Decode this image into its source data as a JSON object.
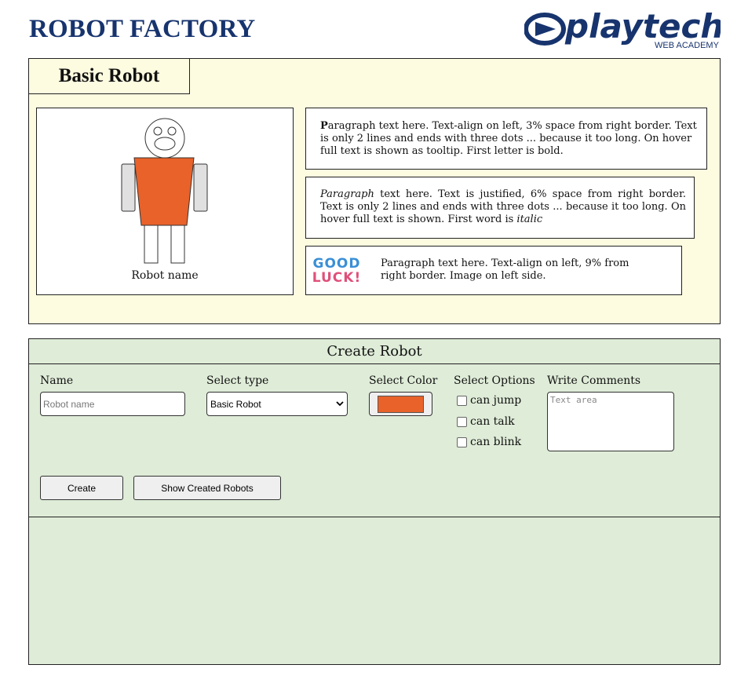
{
  "header": {
    "title": "ROBOT FACTORY",
    "logo": {
      "brand": "playtech",
      "subtitle": "WEB ACADEMY",
      "color": "#17346e"
    }
  },
  "robot_panel": {
    "tab_label": "Basic Robot",
    "robot_name": "Robot name",
    "robot_color": "#e8622a",
    "paragraphs": {
      "p1": {
        "first_letter": "P",
        "rest": "aragraph text here. Text-align on left, 3% space from right border. Text is only 2 lines and ends with three dots ... because it too long. On hover full text is shown as tooltip. First letter is bold."
      },
      "p2": {
        "first_word": "Paragraph",
        "middle": " text here. Text is justified, 6% space from right border. Text is only 2 lines and ends with three dots ... because it too long. On hover full text is shown. First word is ",
        "last_word": "italic"
      },
      "p3": {
        "image_text": [
          "GOOD",
          "LUCK!"
        ],
        "text": "Paragraph text here. Text-align on left, 9% from right border. Image on left side."
      }
    }
  },
  "create_panel": {
    "title": "Create Robot",
    "name_label": "Name",
    "name_placeholder": "Robot name",
    "type_label": "Select type",
    "type_selected": "Basic Robot",
    "color_label": "Select Color",
    "color_value": "#e8622a",
    "options_label": "Select Options",
    "options": [
      {
        "label": "can jump",
        "checked": false
      },
      {
        "label": "can talk",
        "checked": false
      },
      {
        "label": "can blink",
        "checked": false
      }
    ],
    "comments_label": "Write Comments",
    "comments_placeholder": "Text area",
    "create_button": "Create",
    "show_button": "Show Created Robots"
  }
}
